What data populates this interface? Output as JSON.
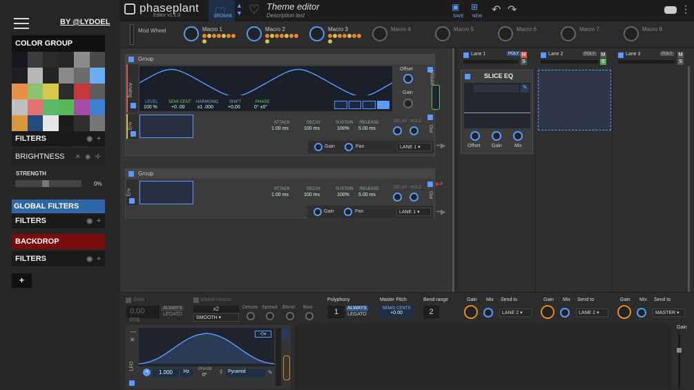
{
  "sidebar": {
    "byline": "BY @LYDOEL",
    "color_group": "COLOR GROUP",
    "swatches": [
      "#17181c",
      "#3b3c3e",
      "#2a2a2a",
      "#262626",
      "#8c8c8c",
      "#4a4a4a",
      "#1d1e22",
      "#b7b7b7",
      "#242424",
      "#8a8a8a",
      "#6b6b6b",
      "#6aaef8",
      "#e98f46",
      "#8dc36c",
      "#d9c84c",
      "#2b2b2b",
      "#c7383a",
      "#5e5d5d",
      "#bfbfbf",
      "#e57272",
      "#5bb867",
      "#59b95a",
      "#a64ca4",
      "#3f7fd6",
      "#d8963f",
      "#244a7d",
      "#e7e7e7",
      "#1d1d1d",
      "#303030",
      "#777777",
      "#282828",
      "#222222",
      "#2a2a2a",
      "#262626",
      "#2d2d2d",
      "#252525"
    ],
    "filters1": "FILTERS",
    "brightness": "BRIGHTNESS",
    "strength_label": "STRENGTH",
    "strength_value": "0%",
    "strength_level": 0.45,
    "global_filters": "GLOBAL FILTERS",
    "filters2": "FILTERS",
    "backdrop": "BACKDROP",
    "filters3": "FILTERS",
    "add": "+"
  },
  "topbar": {
    "logo": "phaseplant",
    "version": "Editor v1.1.0",
    "browse": "BROWSE",
    "theme_title": "Theme editor",
    "theme_desc": "Description text",
    "save": "SAVE",
    "new": "NEW"
  },
  "macros": {
    "modwheel": "Mod Wheel",
    "items": [
      "Macro 1",
      "Macro 2",
      "Macro 3",
      "Macro 4",
      "Macro 5",
      "Macro 6",
      "Macro 7",
      "Macro 8"
    ]
  },
  "group1": {
    "title": "Group",
    "side_label": "Analog",
    "level_lbl": "LEVEL",
    "level": "100 %",
    "semi_lbl": "SEMI CENT",
    "semi": "+0 .00",
    "harm_lbl": "HARMONIC",
    "harm": "x1 .000",
    "shift_lbl": "SHIFT",
    "shift": "+0.00",
    "phase_lbl": "PHASE",
    "phase": "0° ±0°",
    "offset": "Offset",
    "gain": "Gain",
    "unison": "Unison",
    "env_label": "Env",
    "attack_lbl": "ATTACK",
    "attack": "1.00 ms",
    "decay_lbl": "DECAY",
    "decay": "100 ms",
    "sustain_lbl": "SUSTAIN",
    "sustain": "100%",
    "release_lbl": "RELEASE",
    "release": "5.00 ms",
    "delay_lbl": "DELAY",
    "hold_lbl": "HOLD",
    "out": "Out",
    "gain2": "Gain",
    "pan": "Pan",
    "lane": "LANE 1"
  },
  "group2": {
    "title": "Group",
    "env_label": "Env",
    "attack_lbl": "ATTACK",
    "attack": "1.00 ms",
    "decay_lbl": "DECAY",
    "decay": "100 ms",
    "sustain_lbl": "SUSTAIN",
    "sustain": "100%",
    "release_lbl": "RELEASE",
    "release": "5.00 ms",
    "delay_lbl": "DELAY",
    "hold_lbl": "HOLD",
    "out": "Out",
    "gain": "Gain",
    "pan": "Pan",
    "lane": "LANE 1"
  },
  "lanes": {
    "items": [
      {
        "name": "Lane 1",
        "poly": "POLY",
        "m": "M",
        "s": "S"
      },
      {
        "name": "Lane 2",
        "poly": "POLY",
        "m": "M",
        "s": "S"
      },
      {
        "name": "Lane 3",
        "poly": "POLY",
        "m": "M",
        "s": "S"
      }
    ],
    "slice_eq": "SLICE EQ",
    "offset": "Offset",
    "gain": "Gain",
    "mix": "Mix"
  },
  "bottom": {
    "glide": "Glide",
    "global_unison": "Global Unison",
    "glide_val": "0.00 ms",
    "always": "ALWAYS",
    "legato": "LEGATO",
    "x2": "x2",
    "smooth": "SMOOTH",
    "detune": "Detune",
    "spread": "Spread",
    "blend": "Blend",
    "bias": "Bias",
    "polyphony": "Polyphony",
    "poly_val": "1",
    "poly_always": "ALWAYS",
    "poly_legato": "LEGATO",
    "master_pitch": "Master Pitch",
    "semis_cents": "SEMIS CENTS",
    "pitch_val": "+0.00",
    "bend_range": "Bend range",
    "bend_val": "2",
    "sends": [
      {
        "gain": "Gain",
        "mix": "Mix",
        "send": "Send to",
        "target": "LANE 2"
      },
      {
        "gain": "Gain",
        "mix": "Mix",
        "send": "Send to",
        "target": "LANE 2"
      },
      {
        "gain": "Gain",
        "mix": "Mix",
        "send": "Send to",
        "target": "MASTER"
      }
    ],
    "lfo_label": "LFO",
    "lfo_rate": "1.000",
    "lfo_unit": "Hz",
    "lfo_phase_lbl": "PHASE",
    "lfo_phase": "0°",
    "lfo_shape": "Pyramid",
    "gain_right": "Gain"
  }
}
